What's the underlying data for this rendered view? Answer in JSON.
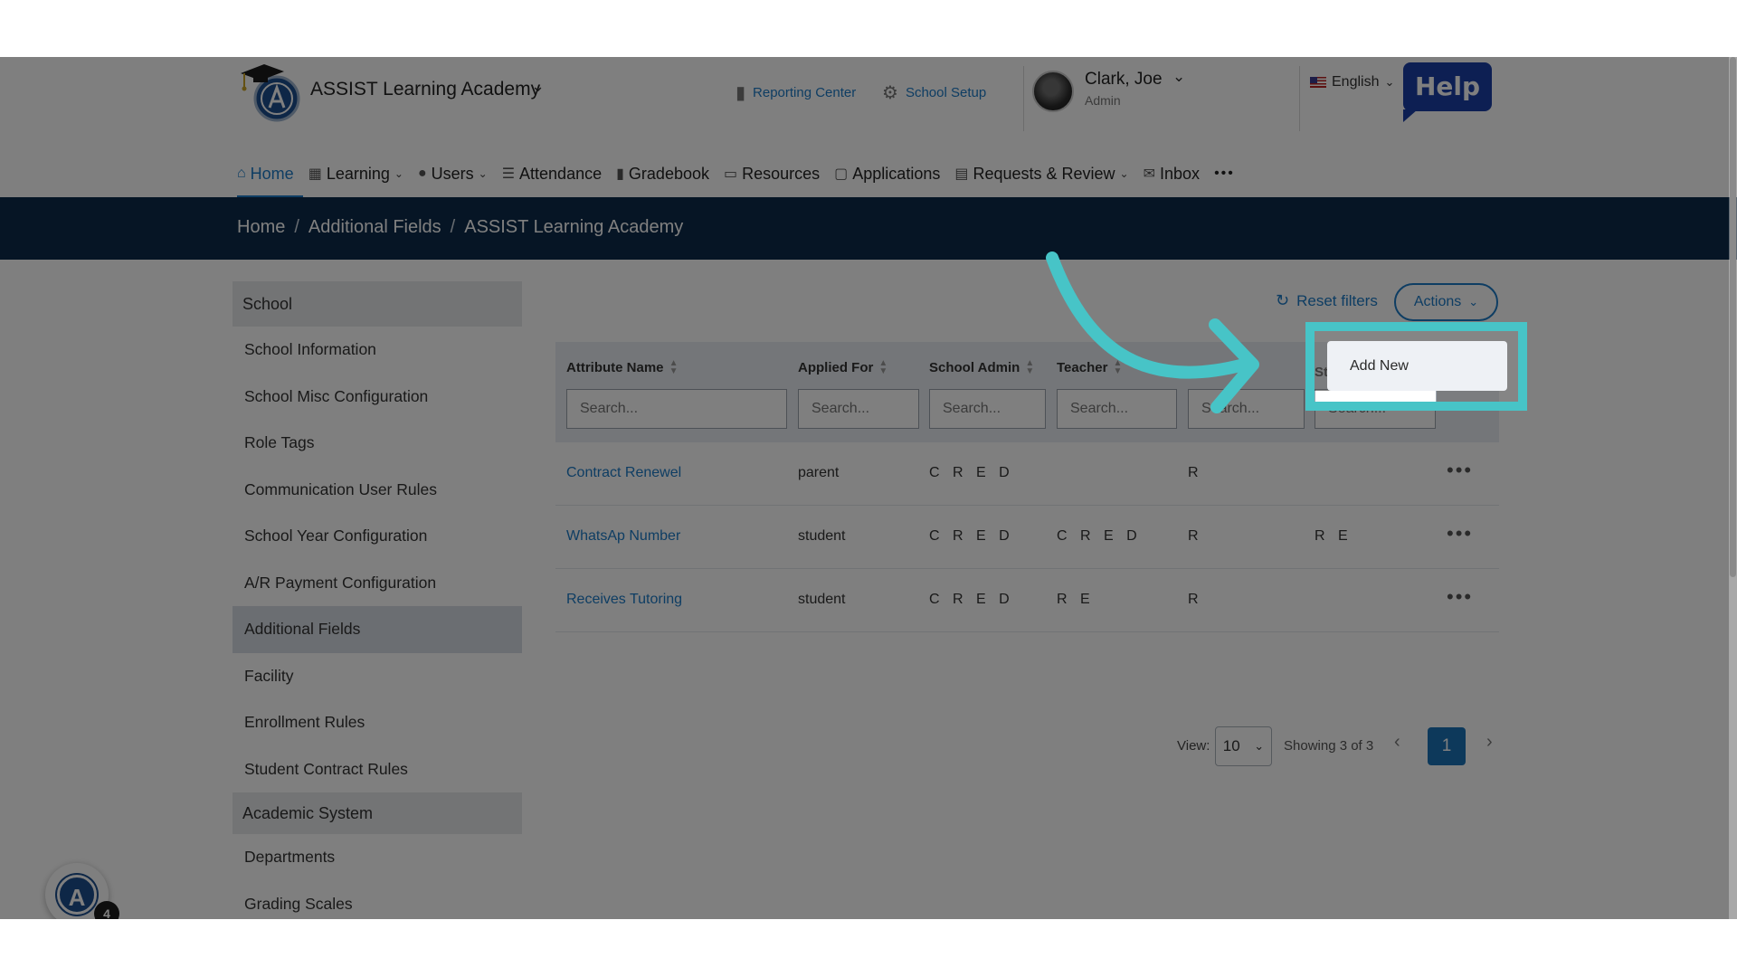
{
  "header": {
    "school_name": "ASSIST Learning Academy",
    "reporting_center": "Reporting Center",
    "school_setup": "School Setup",
    "user_name": "Clark, Joe",
    "user_role": "Admin",
    "language": "English",
    "help_label": "Help"
  },
  "nav": {
    "items": [
      {
        "label": "Home"
      },
      {
        "label": "Learning"
      },
      {
        "label": "Users"
      },
      {
        "label": "Attendance"
      },
      {
        "label": "Gradebook"
      },
      {
        "label": "Resources"
      },
      {
        "label": "Applications"
      },
      {
        "label": "Requests & Review"
      },
      {
        "label": "Inbox"
      }
    ],
    "more": "•••"
  },
  "breadcrumb": [
    "Home",
    "Additional Fields",
    "ASSIST Learning Academy"
  ],
  "sidebar": {
    "section_school": "School",
    "items": [
      "School Information",
      "School Misc Configuration",
      "Role Tags",
      "Communication User Rules",
      "School Year Configuration",
      "A/R Payment Configuration",
      "Additional Fields",
      "Facility",
      "Enrollment Rules",
      "Student Contract Rules"
    ],
    "section_academic": "Academic System",
    "academic_items": [
      "Departments",
      "Grading Scales"
    ]
  },
  "toolbar": {
    "reset_filters": "Reset filters",
    "actions": "Actions"
  },
  "table": {
    "columns": [
      "Attribute Name",
      "Applied For",
      "School Admin",
      "Teacher",
      "St"
    ],
    "search_placeholder": "Search...",
    "rows": [
      {
        "name": "Contract Renewel",
        "applied_for": "parent",
        "school_admin": "C R E D",
        "teacher": "",
        "parent": "R",
        "student": ""
      },
      {
        "name": "WhatsAp Number",
        "applied_for": "student",
        "school_admin": "C R E D",
        "teacher": "C R E D",
        "parent": "R",
        "student": "R E"
      },
      {
        "name": "Receives Tutoring",
        "applied_for": "student",
        "school_admin": "C R E D",
        "teacher": "R E",
        "parent": "R",
        "student": ""
      }
    ],
    "row_menu": "•••"
  },
  "pagination": {
    "view_label": "View:",
    "page_size": "10",
    "showing": "Showing 3 of 3",
    "current_page": "1"
  },
  "dropdown": {
    "add_new": "Add New"
  },
  "widget": {
    "logo_letter": "A",
    "badge": "4"
  },
  "colors": {
    "accent": "#1c7ac6",
    "breadcrumb_bg": "#0d2a4a",
    "spotlight": "#47c4c7",
    "help": "#1b3fa7"
  }
}
